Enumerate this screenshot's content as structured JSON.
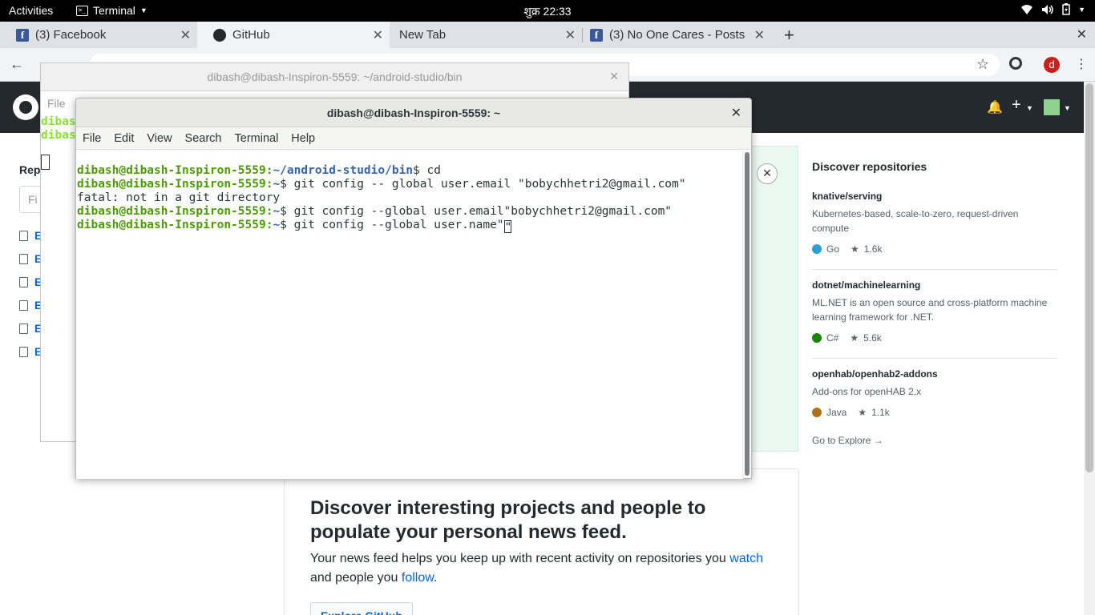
{
  "topbar": {
    "activities": "Activities",
    "app_name": "Terminal",
    "app_icon": ">_",
    "clock": "शुक्र  22:33"
  },
  "browser": {
    "tabs": [
      {
        "label": "(3) Facebook",
        "icon": "facebook-icon"
      },
      {
        "label": "GitHub",
        "icon": "github-icon"
      },
      {
        "label": "New Tab",
        "icon": ""
      },
      {
        "label": "(3) No One Cares - Posts",
        "icon": "facebook-icon"
      }
    ],
    "profile_initial": "d"
  },
  "github": {
    "repos_label": "Rep",
    "find_placeholder": "Fi",
    "repo_letters": [
      "E",
      "E",
      "E",
      "E",
      "E",
      "E"
    ],
    "discover_repos_title": "Discover repositories",
    "discover_repos": [
      {
        "name": "knative/serving",
        "desc": "Kubernetes-based, scale-to-zero, request-driven compute",
        "lang": "Go",
        "lang_color": "#2b9fd8",
        "stars": "1.6k"
      },
      {
        "name": "dotnet/machinelearning",
        "desc": "ML.NET is an open source and cross-platform machine learning framework for .NET.",
        "lang": "C#",
        "lang_color": "#178600",
        "stars": "5.6k"
      },
      {
        "name": "openhab/openhab2-addons",
        "desc": "Add-ons for openHAB 2.x",
        "lang": "Java",
        "lang_color": "#b07219",
        "stars": "1.1k"
      }
    ],
    "explore_link": "Go to Explore →",
    "feed_heading": "Discover interesting projects and people to populate your personal news feed.",
    "feed_text_1": "Your news feed helps you keep up with recent activity on repositories you ",
    "feed_link_watch": "watch",
    "feed_text_2": "and people you ",
    "feed_link_follow": "follow",
    "feed_text_3": ".",
    "explore_button": "Explore GitHub"
  },
  "terminal_back": {
    "title": "dibash@dibash-Inspiron-5559: ~/android-studio/bin",
    "menu_first": "File",
    "line_prefix": "dibas"
  },
  "terminal_front": {
    "title": "dibash@dibash-Inspiron-5559: ~",
    "menu": [
      "File",
      "Edit",
      "View",
      "Search",
      "Terminal",
      "Help"
    ],
    "lines": [
      {
        "host": "dibash@dibash-Inspiron-5559",
        "path": "~/android-studio/bin",
        "cmd": "$ cd"
      },
      {
        "host": "dibash@dibash-Inspiron-5559",
        "path": "~",
        "cmd": "$ git config -- global user.email \"bobychhetri2@gmail.com\""
      },
      {
        "text": "fatal: not in a git directory"
      },
      {
        "host": "dibash@dibash-Inspiron-5559",
        "path": "~",
        "cmd": "$ git config --global user.email\"bobychhetri2@gmail.com\""
      },
      {
        "host": "dibash@dibash-Inspiron-5559",
        "path": "~",
        "cmd": "$ git config --global user.name\""
      }
    ],
    "cursor_char": "\""
  }
}
